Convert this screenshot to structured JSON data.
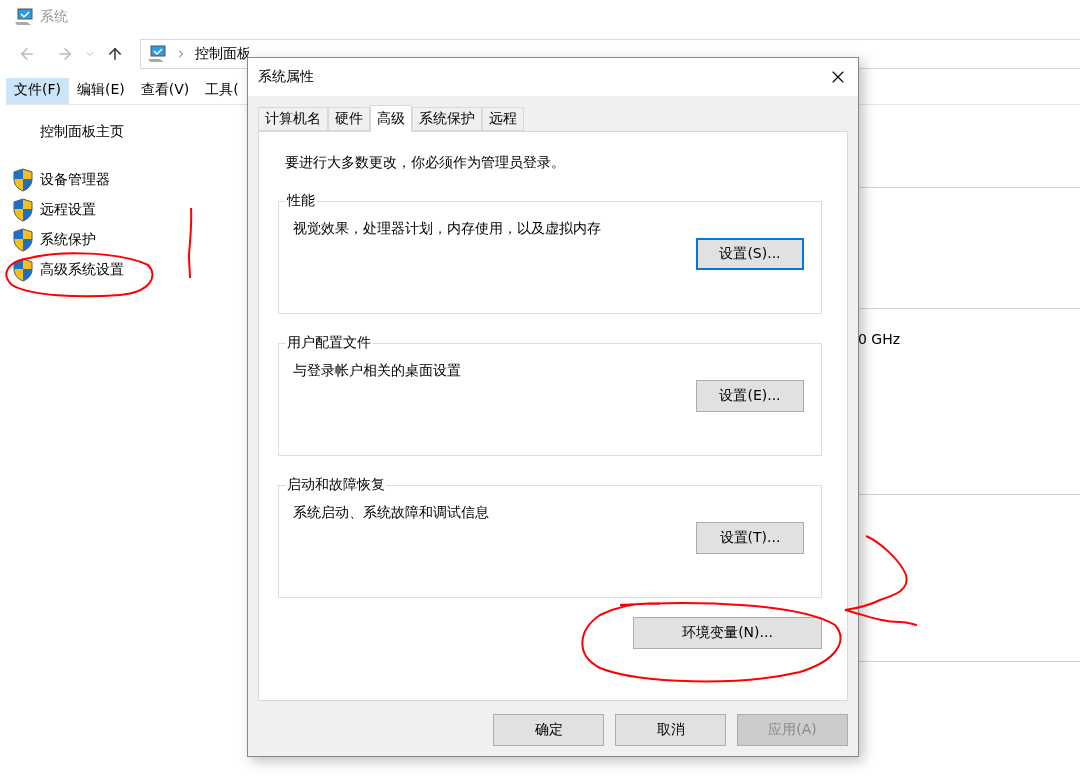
{
  "explorer": {
    "title": "系统",
    "breadcrumb": [
      "控制面板"
    ],
    "menu": [
      {
        "label": "文件(F)",
        "selected": true
      },
      {
        "label": "编辑(E)",
        "selected": false
      },
      {
        "label": "查看(V)",
        "selected": false
      },
      {
        "label": "工具(",
        "selected": false
      }
    ],
    "sidebar": {
      "home": "控制面板主页",
      "links": [
        "设备管理器",
        "远程设置",
        "系统保护",
        "高级系统设置"
      ]
    },
    "content_text": "0 GHz"
  },
  "dialog": {
    "title": "系统属性",
    "tabs": [
      {
        "label": "计算机名",
        "selected": false
      },
      {
        "label": "硬件",
        "selected": false
      },
      {
        "label": "高级",
        "selected": true
      },
      {
        "label": "系统保护",
        "selected": false
      },
      {
        "label": "远程",
        "selected": false
      }
    ],
    "notice": "要进行大多数更改，你必须作为管理员登录。",
    "groups": [
      {
        "title": "性能",
        "description": "视觉效果，处理器计划，内存使用，以及虚拟内存",
        "button": "设置(S)...",
        "focused": true
      },
      {
        "title": "用户配置文件",
        "description": "与登录帐户相关的桌面设置",
        "button": "设置(E)...",
        "focused": false
      },
      {
        "title": "启动和故障恢复",
        "description": "系统启动、系统故障和调试信息",
        "button": "设置(T)...",
        "focused": false
      }
    ],
    "env_button": "环境变量(N)...",
    "buttons": [
      {
        "label": "确定",
        "disabled": false
      },
      {
        "label": "取消",
        "disabled": false
      },
      {
        "label": "应用(A)",
        "disabled": true
      }
    ]
  }
}
